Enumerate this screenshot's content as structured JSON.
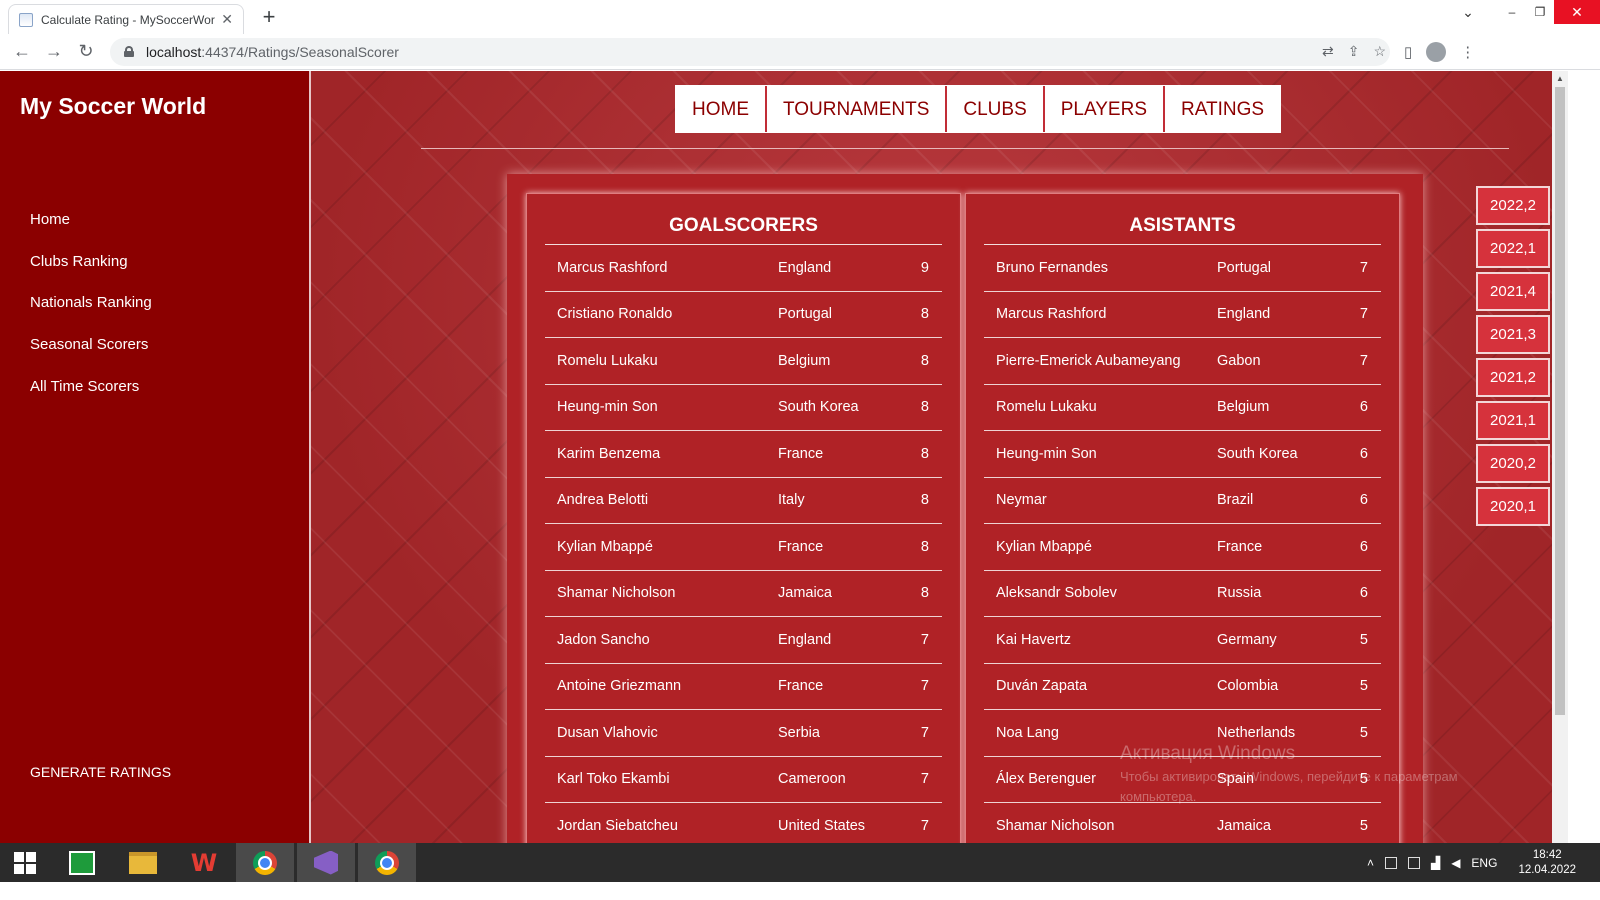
{
  "browser": {
    "tab_title": "Calculate Rating - MySoccerWorld",
    "tab_close": "✕",
    "new_tab": "+",
    "url_host": "localhost",
    "url_path": ":44374/Ratings/SeasonalScorer",
    "window_controls": {
      "tab_list": "⌄",
      "minimize": "–",
      "restore": "❐",
      "close": "✕"
    }
  },
  "sidebar": {
    "brand": "My Soccer World",
    "items": [
      {
        "label": "Home"
      },
      {
        "label": "Clubs Ranking"
      },
      {
        "label": "Nationals Ranking"
      },
      {
        "label": "Seasonal Scorers"
      },
      {
        "label": "All Time Scorers"
      }
    ],
    "generate_label": "GENERATE RATINGS"
  },
  "topnav": [
    "HOME",
    "TOURNAMENTS",
    "CLUBS",
    "PLAYERS",
    "RATINGS"
  ],
  "goalscorers": {
    "title": "GOALSCORERS",
    "rows": [
      [
        "Marcus Rashford",
        "England",
        "9"
      ],
      [
        "Cristiano Ronaldo",
        "Portugal",
        "8"
      ],
      [
        "Romelu Lukaku",
        "Belgium",
        "8"
      ],
      [
        "Heung-min Son",
        "South Korea",
        "8"
      ],
      [
        "Karim Benzema",
        "France",
        "8"
      ],
      [
        "Andrea Belotti",
        "Italy",
        "8"
      ],
      [
        "Kylian Mbappé",
        "France",
        "8"
      ],
      [
        "Shamar Nicholson",
        "Jamaica",
        "8"
      ],
      [
        "Jadon Sancho",
        "England",
        "7"
      ],
      [
        "Antoine Griezmann",
        "France",
        "7"
      ],
      [
        "Dusan Vlahovic",
        "Serbia",
        "7"
      ],
      [
        "Karl Toko Ekambi",
        "Cameroon",
        "7"
      ],
      [
        "Jordan Siebatcheu",
        "United States",
        "7"
      ]
    ]
  },
  "assistants": {
    "title": "ASISTANTS",
    "rows": [
      [
        "Bruno Fernandes",
        "Portugal",
        "7"
      ],
      [
        "Marcus Rashford",
        "England",
        "7"
      ],
      [
        "Pierre-Emerick Aubameyang",
        "Gabon",
        "7"
      ],
      [
        "Romelu Lukaku",
        "Belgium",
        "6"
      ],
      [
        "Heung-min Son",
        "South Korea",
        "6"
      ],
      [
        "Neymar",
        "Brazil",
        "6"
      ],
      [
        "Kylian Mbappé",
        "France",
        "6"
      ],
      [
        "Aleksandr Sobolev",
        "Russia",
        "6"
      ],
      [
        "Kai Havertz",
        "Germany",
        "5"
      ],
      [
        "Duván Zapata",
        "Colombia",
        "5"
      ],
      [
        "Noa Lang",
        "Netherlands",
        "5"
      ],
      [
        "Álex Berenguer",
        "Spain",
        "5"
      ],
      [
        "Shamar Nicholson",
        "Jamaica",
        "5"
      ]
    ]
  },
  "seasons": [
    "2022,2",
    "2022,1",
    "2021,4",
    "2021,3",
    "2021,2",
    "2021,1",
    "2020,2",
    "2020,1"
  ],
  "watermark": {
    "title": "Активация Windows",
    "line1": "Чтобы активировать Windows, перейдите к параметрам",
    "line2": "компьютера."
  },
  "taskbar": {
    "lang": "ENG",
    "time": "18:42",
    "date": "12.04.2022"
  },
  "colors": {
    "sidebar": "#8b0000",
    "panel": "#b02226",
    "season_button": "#d6323c",
    "nav_text": "#8b0000"
  }
}
